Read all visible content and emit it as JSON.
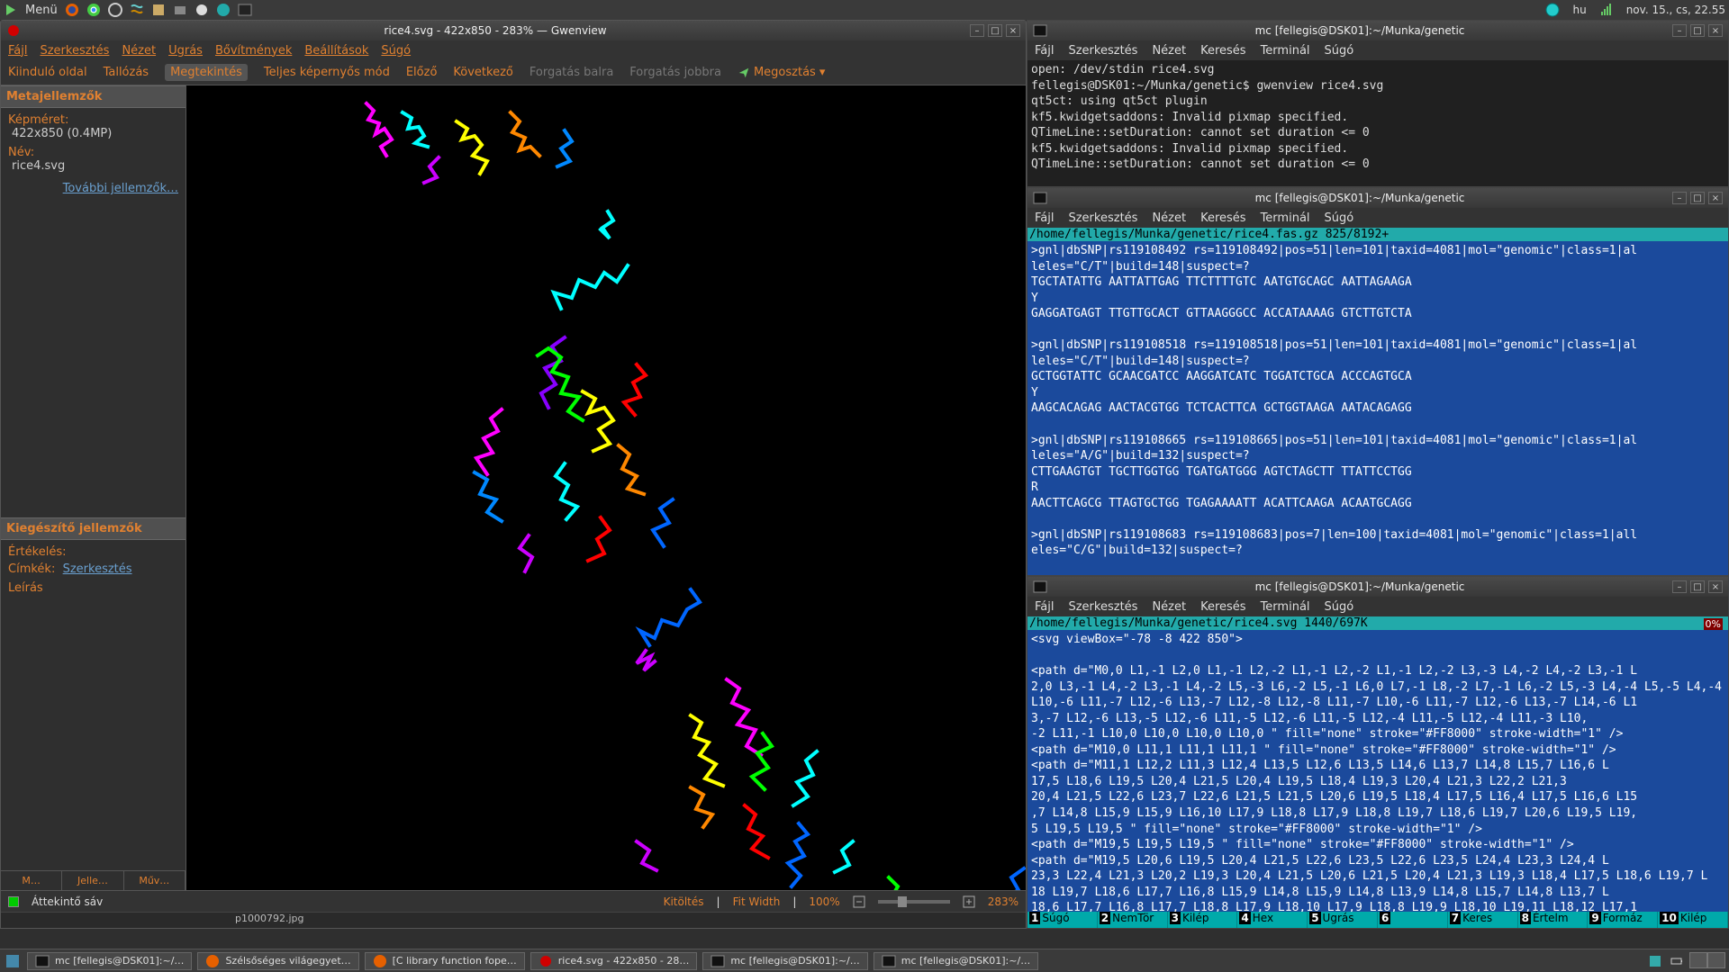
{
  "panel": {
    "menu": "Menü",
    "lang": "hu",
    "clock": "nov. 15., cs, 22.55"
  },
  "gwenview": {
    "title": "rice4.svg - 422x850 - 283% — Gwenview",
    "menubar": [
      "Fájl",
      "Szerkesztés",
      "Nézet",
      "Ugrás",
      "Bővítmények",
      "Beállítások",
      "Súgó"
    ],
    "toolbar": {
      "start": "Kiinduló oldal",
      "browse": "Tallózás",
      "view": "Megtekintés",
      "fullscreen": "Teljes képernyős mód",
      "prev": "Előző",
      "next": "Következő",
      "rotleft": "Forgatás balra",
      "rotright": "Forgatás jobbra",
      "share": "Megosztás"
    },
    "meta": {
      "head": "Metajellemzők",
      "size_lbl": "Képméret:",
      "size_val": "422x850 (0.4MP)",
      "name_lbl": "Név:",
      "name_val": "rice4.svg",
      "more_link": "További jellemzők…",
      "supp_head": "Kiegészítő jellemzők",
      "rating_lbl": "Értékelés:",
      "tags_lbl": "Címkék:",
      "tags_link": "Szerkesztés",
      "desc_lbl": "Leírás"
    },
    "bottom_tabs": [
      "M…",
      "Jelle…",
      "Műv…"
    ],
    "statusbar": {
      "thumb": "Áttekintő sáv",
      "fill": "Kitöltés",
      "fitw": "Fit Width",
      "hundred": "100%",
      "zoom": "283%"
    },
    "filmstrip": "p1000792.jpg"
  },
  "term_menu": [
    "Fájl",
    "Szerkesztés",
    "Nézet",
    "Keresés",
    "Terminál",
    "Súgó"
  ],
  "term_title": "mc [fellegis@DSK01]:~/Munka/genetic",
  "term1": {
    "body": "open: /dev/stdin rice4.svg\nfellegis@DSK01:~/Munka/genetic$ gwenview rice4.svg\nqt5ct: using qt5ct plugin\nkf5.kwidgetsaddons: Invalid pixmap specified.\nQTimeLine::setDuration: cannot set duration <= 0\nkf5.kwidgetsaddons: Invalid pixmap specified.\nQTimeLine::setDuration: cannot set duration <= 0"
  },
  "term2": {
    "topline": "/home/fellegis/Munka/genetic/rice4.fas.gz              825/8192+",
    "body": ">gnl|dbSNP|rs119108492 rs=119108492|pos=51|len=101|taxid=4081|mol=\"genomic\"|class=1|al\nleles=\"C/T\"|build=148|suspect=?\nTGCTATATTG AATTATTGAG TTCTTTTGTC AATGTGCAGC AATTAGAAGA\nY\nGAGGATGAGT TTGTTGCACT GTTAAGGGCC ACCATAAAAG GTCTTGTCTA\n\n>gnl|dbSNP|rs119108518 rs=119108518|pos=51|len=101|taxid=4081|mol=\"genomic\"|class=1|al\nleles=\"C/T\"|build=148|suspect=?\nGCTGGTATTC GCAACGATCC AAGGATCATC TGGATCTGCA ACCCAGTGCA\nY\nAAGCACAGAG AACTACGTGG TCTCACTTCA GCTGGTAAGA AATACAGAGG\n\n>gnl|dbSNP|rs119108665 rs=119108665|pos=51|len=101|taxid=4081|mol=\"genomic\"|class=1|al\nleles=\"A/G\"|build=132|suspect=?\nCTTGAAGTGT TGCTTGGTGG TGATGATGGG AGTCTAGCTT TTATTCCTGG\nR\nAACTTCAGCG TTAGTGCTGG TGAGAAAATT ACATTCAAGA ACAATGCAGG\n\n>gnl|dbSNP|rs119108683 rs=119108683|pos=7|len=100|taxid=4081|mol=\"genomic\"|class=1|all\neles=\"C/G\"|build=132|suspect=?"
  },
  "term3": {
    "topline": "/home/fellegis/Munka/genetic/rice4.svg               1440/697K",
    "pct": "0%",
    "body": "<svg viewBox=\"-78 -8 422 850\">\n\n<path d=\"M0,0 L1,-1 L2,0 L1,-1 L2,-2 L1,-1 L2,-2 L1,-1 L2,-2 L3,-3 L4,-2 L4,-2 L3,-1 L\n2,0 L3,-1 L4,-2 L3,-1 L4,-2 L5,-3 L6,-2 L5,-1 L6,0 L7,-1 L8,-2 L7,-1 L6,-2 L5,-3 L4,-4 L5,-5 L4,-4 L9,-5\nL10,-6 L11,-7 L12,-6 L13,-7 L12,-8 L12,-8 L11,-7 L10,-6 L11,-7 L12,-6 L13,-7 L14,-6 L1\n3,-7 L12,-6 L13,-5 L12,-6 L11,-5 L12,-6 L11,-5 L12,-4 L11,-5 L12,-4 L11,-3 L10,\n-2 L11,-1 L10,0 L10,0 L10,0 L10,0 \" fill=\"none\" stroke=\"#FF8000\" stroke-width=\"1\" />\n<path d=\"M10,0 L11,1 L11,1 L11,1 \" fill=\"none\" stroke=\"#FF8000\" stroke-width=\"1\" />\n<path d=\"M11,1 L12,2 L11,3 L12,4 L13,5 L12,6 L13,5 L14,6 L13,7 L14,8 L15,7 L16,6 L\n17,5 L18,6 L19,5 L20,4 L21,5 L20,4 L19,5 L18,4 L19,3 L20,4 L21,3 L22,2 L21,3\n20,4 L21,5 L22,6 L23,7 L22,6 L21,5 L21,5 L20,6 L19,5 L18,4 L17,5 L16,4 L17,5 L16,6 L15\n,7 L14,8 L15,9 L15,9 L16,10 L17,9 L18,8 L17,9 L18,8 L19,7 L18,6 L19,7 L20,6 L19,5 L19,\n5 L19,5 L19,5 \" fill=\"none\" stroke=\"#FF8000\" stroke-width=\"1\" />\n<path d=\"M19,5 L19,5 L19,5 \" fill=\"none\" stroke=\"#FF8000\" stroke-width=\"1\" />\n<path d=\"M19,5 L20,6 L19,5 L20,4 L21,5 L22,6 L23,5 L22,6 L23,5 L24,4 L23,3 L24,4 L\n23,3 L22,4 L21,3 L20,2 L19,3 L20,4 L21,5 L20,6 L21,5 L20,4 L21,3 L19,3 L18,4 L17,5 L18,6 L19,7 L\n18 L19,7 L18,6 L17,7 L16,8 L15,9 L14,8 L15,9 L14,8 L13,9 L14,8 L15,7 L14,8 L13,7 L\n18,6 L17,7 L16,8 L17,7 L18,8 L17,9 L18,10 L17,9 L18,8 L19,9 L18,10 L19,11 L18,12 L17,1",
    "fkeys": [
      [
        "1",
        "Súgó"
      ],
      [
        "2",
        "NemTör"
      ],
      [
        "3",
        "Kilép"
      ],
      [
        "4",
        "Hex"
      ],
      [
        "5",
        "Ugrás"
      ],
      [
        "6",
        ""
      ],
      [
        "7",
        "Keres"
      ],
      [
        "8",
        "Értelm"
      ],
      [
        "9",
        "Formáz"
      ],
      [
        "10",
        "Kilép"
      ]
    ]
  },
  "taskbar": {
    "items": [
      "mc [fellegis@DSK01]:~/…",
      "Szélsőséges világegyet…",
      "[C library function fope…",
      "rice4.svg - 422x850 - 28…",
      "mc [fellegis@DSK01]:~/…",
      "mc [fellegis@DSK01]:~/…"
    ]
  }
}
